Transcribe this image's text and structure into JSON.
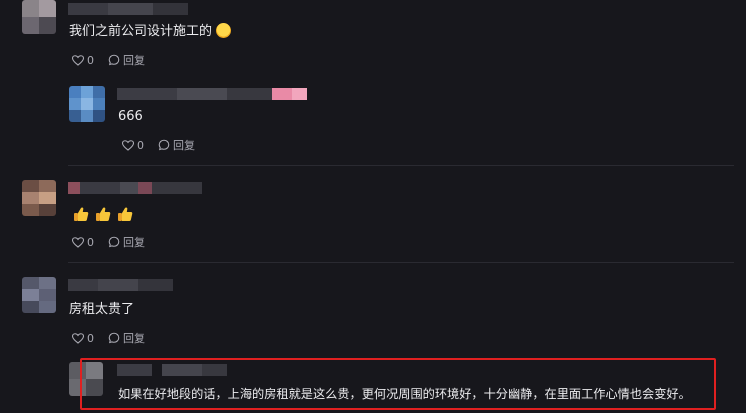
{
  "comments": [
    {
      "text": "我们之前公司设计施工的",
      "emoji_icon": "grinning-face-emoji",
      "likes": "0",
      "reply_label": "回复"
    },
    {
      "text": "666",
      "likes": "0",
      "reply_label": "回复",
      "is_reply": true
    },
    {
      "emoji_icons": [
        "thumbs-up-emoji",
        "thumbs-up-emoji",
        "thumbs-up-emoji"
      ],
      "likes": "0",
      "reply_label": "回复"
    },
    {
      "text": "房租太贵了",
      "likes": "0",
      "reply_label": "回复"
    },
    {
      "text": "如果在好地段的话，上海的房租就是这么贵，更何况周围的环境好，十分幽静，在里面工作心情也会变好。",
      "is_reply": true,
      "highlighted": true
    }
  ],
  "colors": {
    "background": "#17171c",
    "text": "#ececef",
    "muted": "#a9a9b2",
    "highlight_border": "#e02020"
  }
}
